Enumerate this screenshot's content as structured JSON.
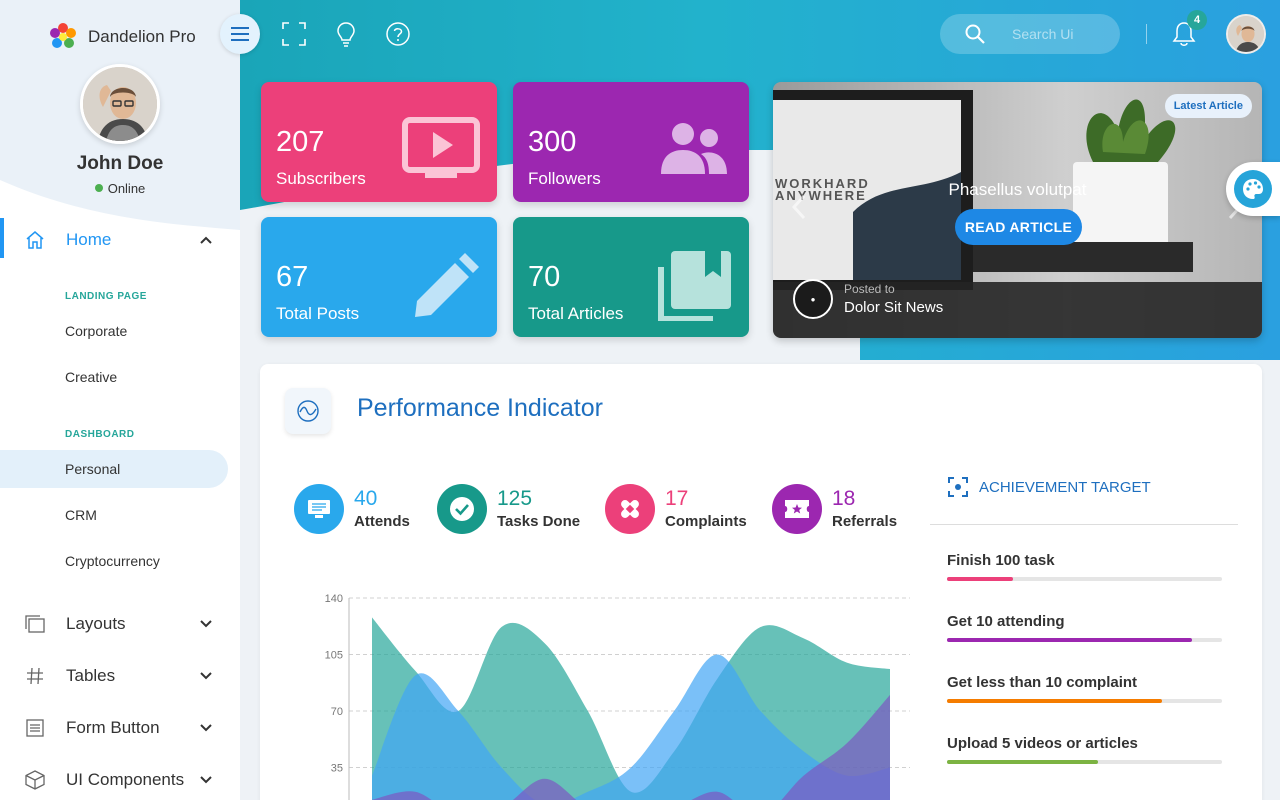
{
  "app": {
    "name": "Dandelion Pro"
  },
  "user": {
    "name": "John Doe",
    "status": "Online"
  },
  "sidebar": {
    "home": {
      "label": "Home"
    },
    "groups": [
      {
        "heading": "LANDING PAGE",
        "items": [
          "Corporate",
          "Creative"
        ]
      },
      {
        "heading": "DASHBOARD",
        "items": [
          "Personal",
          "CRM",
          "Cryptocurrency"
        ]
      }
    ],
    "active_item": "Personal",
    "menus": [
      {
        "label": "Layouts",
        "icon": "layers-icon"
      },
      {
        "label": "Tables",
        "icon": "hash-icon"
      },
      {
        "label": "Form Button",
        "icon": "list-icon"
      },
      {
        "label": "UI Components",
        "icon": "cube-icon"
      }
    ]
  },
  "topbar": {
    "search_placeholder": "Search Ui",
    "notification_count": "4"
  },
  "stats": [
    {
      "value": "207",
      "label": "Subscribers",
      "color": "#ec407a",
      "icon": "tv-play-icon"
    },
    {
      "value": "300",
      "label": "Followers",
      "color": "#9c27b0",
      "icon": "people-icon"
    },
    {
      "value": "67",
      "label": "Total Posts",
      "color": "#29a8ec",
      "icon": "pencil-icon"
    },
    {
      "value": "70",
      "label": "Total Articles",
      "color": "#17998a",
      "icon": "library-icon"
    }
  ],
  "article": {
    "tag": "Latest Article",
    "title": "Phasellus volutpat",
    "button": "READ ARTICLE",
    "posted_label": "Posted to",
    "posted_name": "Dolor Sit News",
    "image_text": [
      "WORKHARD",
      "ANYWHERE"
    ]
  },
  "performance": {
    "title": "Performance Indicator",
    "kpis": [
      {
        "value": "40",
        "label": "Attends",
        "color": "#29a8ec",
        "icon": "monitor-icon"
      },
      {
        "value": "125",
        "label": "Tasks Done",
        "color": "#17998a",
        "icon": "check-icon"
      },
      {
        "value": "17",
        "label": "Complaints",
        "color": "#ec407a",
        "icon": "bandage-icon"
      },
      {
        "value": "18",
        "label": "Referrals",
        "color": "#9c27b0",
        "icon": "ticket-icon"
      }
    ],
    "achievement": {
      "heading": "ACHIEVEMENT TARGET",
      "items": [
        {
          "label": "Finish 100 task",
          "progress": 0.24,
          "color": "#ec407a"
        },
        {
          "label": "Get 10 attending",
          "progress": 0.89,
          "color": "#9c27b0"
        },
        {
          "label": "Get less than 10 complaint",
          "progress": 0.78,
          "color": "#f57c00"
        },
        {
          "label": "Upload 5 videos or articles",
          "progress": 0.55,
          "color": "#7cb342"
        }
      ]
    }
  },
  "chart_data": {
    "type": "area",
    "y_ticks": [
      "140",
      "105",
      "70",
      "35"
    ],
    "ylim": [
      0,
      140
    ],
    "x": [
      0,
      1,
      2,
      3,
      4,
      5,
      6,
      7,
      8,
      9,
      10,
      11,
      12
    ],
    "series": [
      {
        "values": [
          128,
          95,
          70,
          122,
          112,
          70,
          20,
          45,
          90,
          122,
          115,
          100,
          96
        ],
        "color": "#26a69a"
      },
      {
        "values": [
          30,
          92,
          70,
          35,
          12,
          20,
          35,
          70,
          105,
          70,
          45,
          30,
          35
        ],
        "color": "#42a5f5"
      },
      {
        "values": [
          15,
          20,
          5,
          10,
          28,
          10,
          5,
          10,
          20,
          5,
          30,
          50,
          80
        ],
        "color": "#7e57c2"
      }
    ],
    "grid": true
  }
}
